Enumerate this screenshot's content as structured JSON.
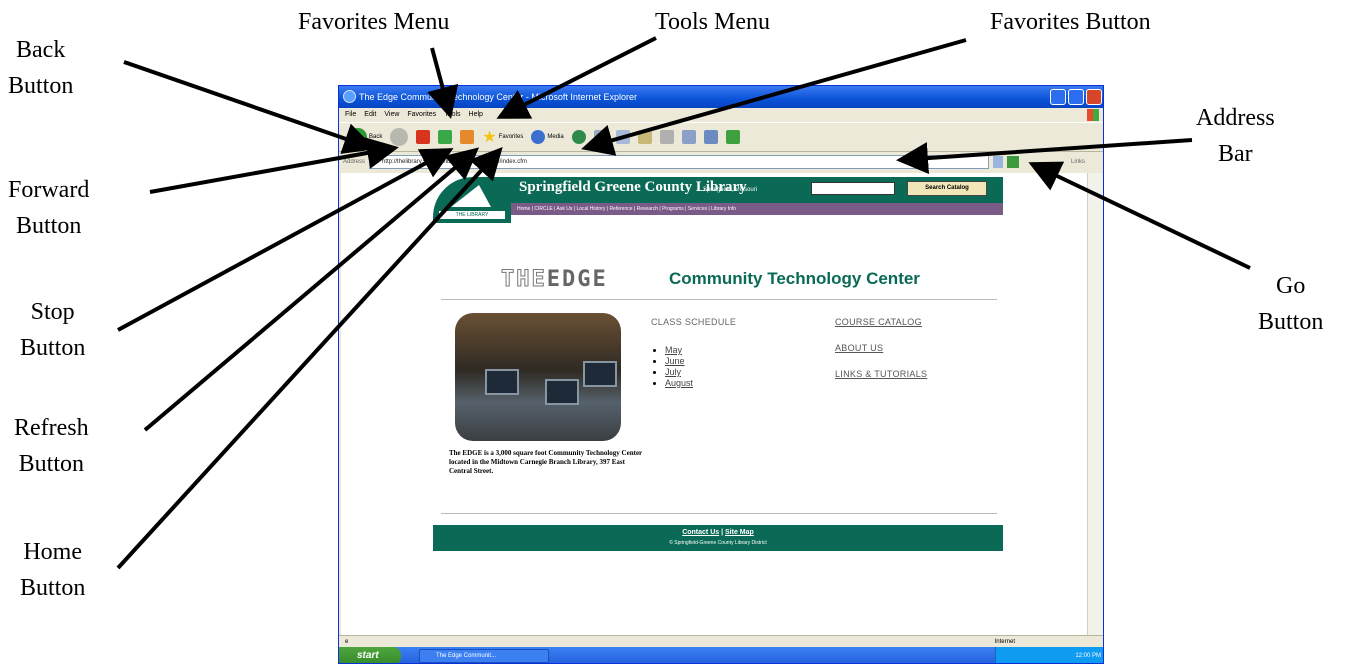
{
  "callouts": {
    "back": [
      "Back",
      "Button"
    ],
    "favorites_menu": "Favorites Menu",
    "tools_menu": "Tools Menu",
    "favorites_button": "Favorites Button",
    "address": [
      "Address",
      "Bar"
    ],
    "forward": [
      "Forward",
      "Button"
    ],
    "go": [
      "Go",
      "Button"
    ],
    "stop": [
      "Stop",
      "Button"
    ],
    "refresh": [
      "Refresh",
      "Button"
    ],
    "home": [
      "Home",
      "Button"
    ]
  },
  "browser": {
    "title": "The Edge Community Technology Center - Microsoft Internet Explorer",
    "menu": [
      "File",
      "Edit",
      "View",
      "Favorites",
      "Tools",
      "Help"
    ],
    "toolbar": {
      "back": "Back",
      "favorites": "Favorites",
      "media": "Media"
    },
    "address_label": "Address",
    "address_url": "http://thelibrary.springfield.missouri.org/edge/index.cfm",
    "links_label": "Links",
    "status_zone": "Internet",
    "start_label": "start",
    "taskbar_item": "The Edge Communit...",
    "clock": "12:00 PM"
  },
  "page": {
    "library_name": "Springfield Greene County Library",
    "library_location": "Springfield, Missouri",
    "logo_tag": "THE LIBRARY",
    "search_button": "Search Catalog",
    "nav": "Home | CIRCLE | Ask Us | Local History | Reference | Research | Programs | Services | Library Info",
    "edge_logo_the": "THE",
    "edge_logo_edge": "EDGE",
    "edge_name": "Community Technology Center",
    "class_schedule": "CLASS SCHEDULE",
    "months": [
      "May",
      "June",
      "July",
      "August"
    ],
    "right_links": [
      "COURSE CATALOG",
      "ABOUT US",
      "LINKS & TUTORIALS"
    ],
    "description": "The EDGE is a 3,000 square foot Community Technology Center located in the Midtown Carnegie Branch Library, 397 East Central Street.",
    "footer_contact": "Contact Us",
    "footer_sitemap": "Site Map",
    "footer_copy": "© Springfield-Greene County Library District"
  }
}
